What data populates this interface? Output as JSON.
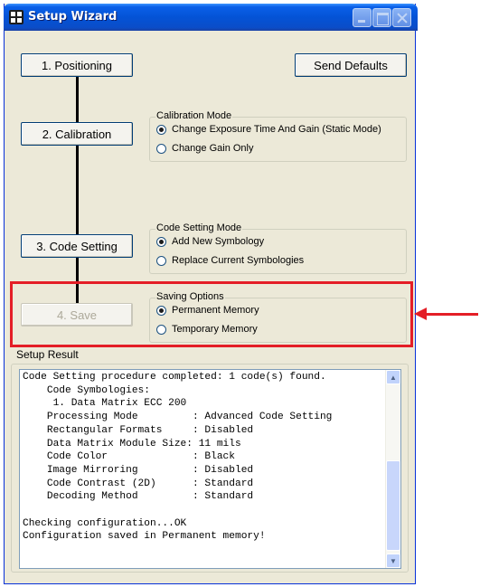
{
  "window": {
    "title": "Setup Wizard"
  },
  "steps": {
    "positioning": "1. Positioning",
    "calibration": "2. Calibration",
    "code_setting": "3. Code Setting",
    "save": "4. Save",
    "save_enabled": false
  },
  "send_defaults": "Send Defaults",
  "calibration_mode": {
    "label": "Calibration Mode",
    "options": [
      {
        "label": "Change Exposure Time And Gain (Static Mode)",
        "selected": true
      },
      {
        "label": "Change Gain Only",
        "selected": false
      }
    ]
  },
  "code_setting_mode": {
    "label": "Code Setting Mode",
    "options": [
      {
        "label": "Add New Symbology",
        "selected": true
      },
      {
        "label": "Replace Current Symbologies",
        "selected": false
      }
    ]
  },
  "saving_options": {
    "label": "Saving Options",
    "options": [
      {
        "label": "Permanent Memory",
        "selected": true
      },
      {
        "label": "Temporary Memory",
        "selected": false
      }
    ]
  },
  "setup_result": {
    "label": "Setup Result",
    "text": "Code Setting procedure completed: 1 code(s) found.\n    Code Symbologies:\n     1. Data Matrix ECC 200\n    Processing Mode         : Advanced Code Setting\n    Rectangular Formats     : Disabled\n    Data Matrix Module Size: 11 mils\n    Code Color              : Black\n    Image Mirroring         : Disabled\n    Code Contrast (2D)      : Standard\n    Decoding Method         : Standard\n\nChecking configuration...OK\nConfiguration saved in Permanent memory!"
  },
  "annotation": {
    "highlight_color": "#e41e26"
  },
  "colors": {
    "titlebar": "#0453d6",
    "window_bg": "#ece9d8"
  }
}
